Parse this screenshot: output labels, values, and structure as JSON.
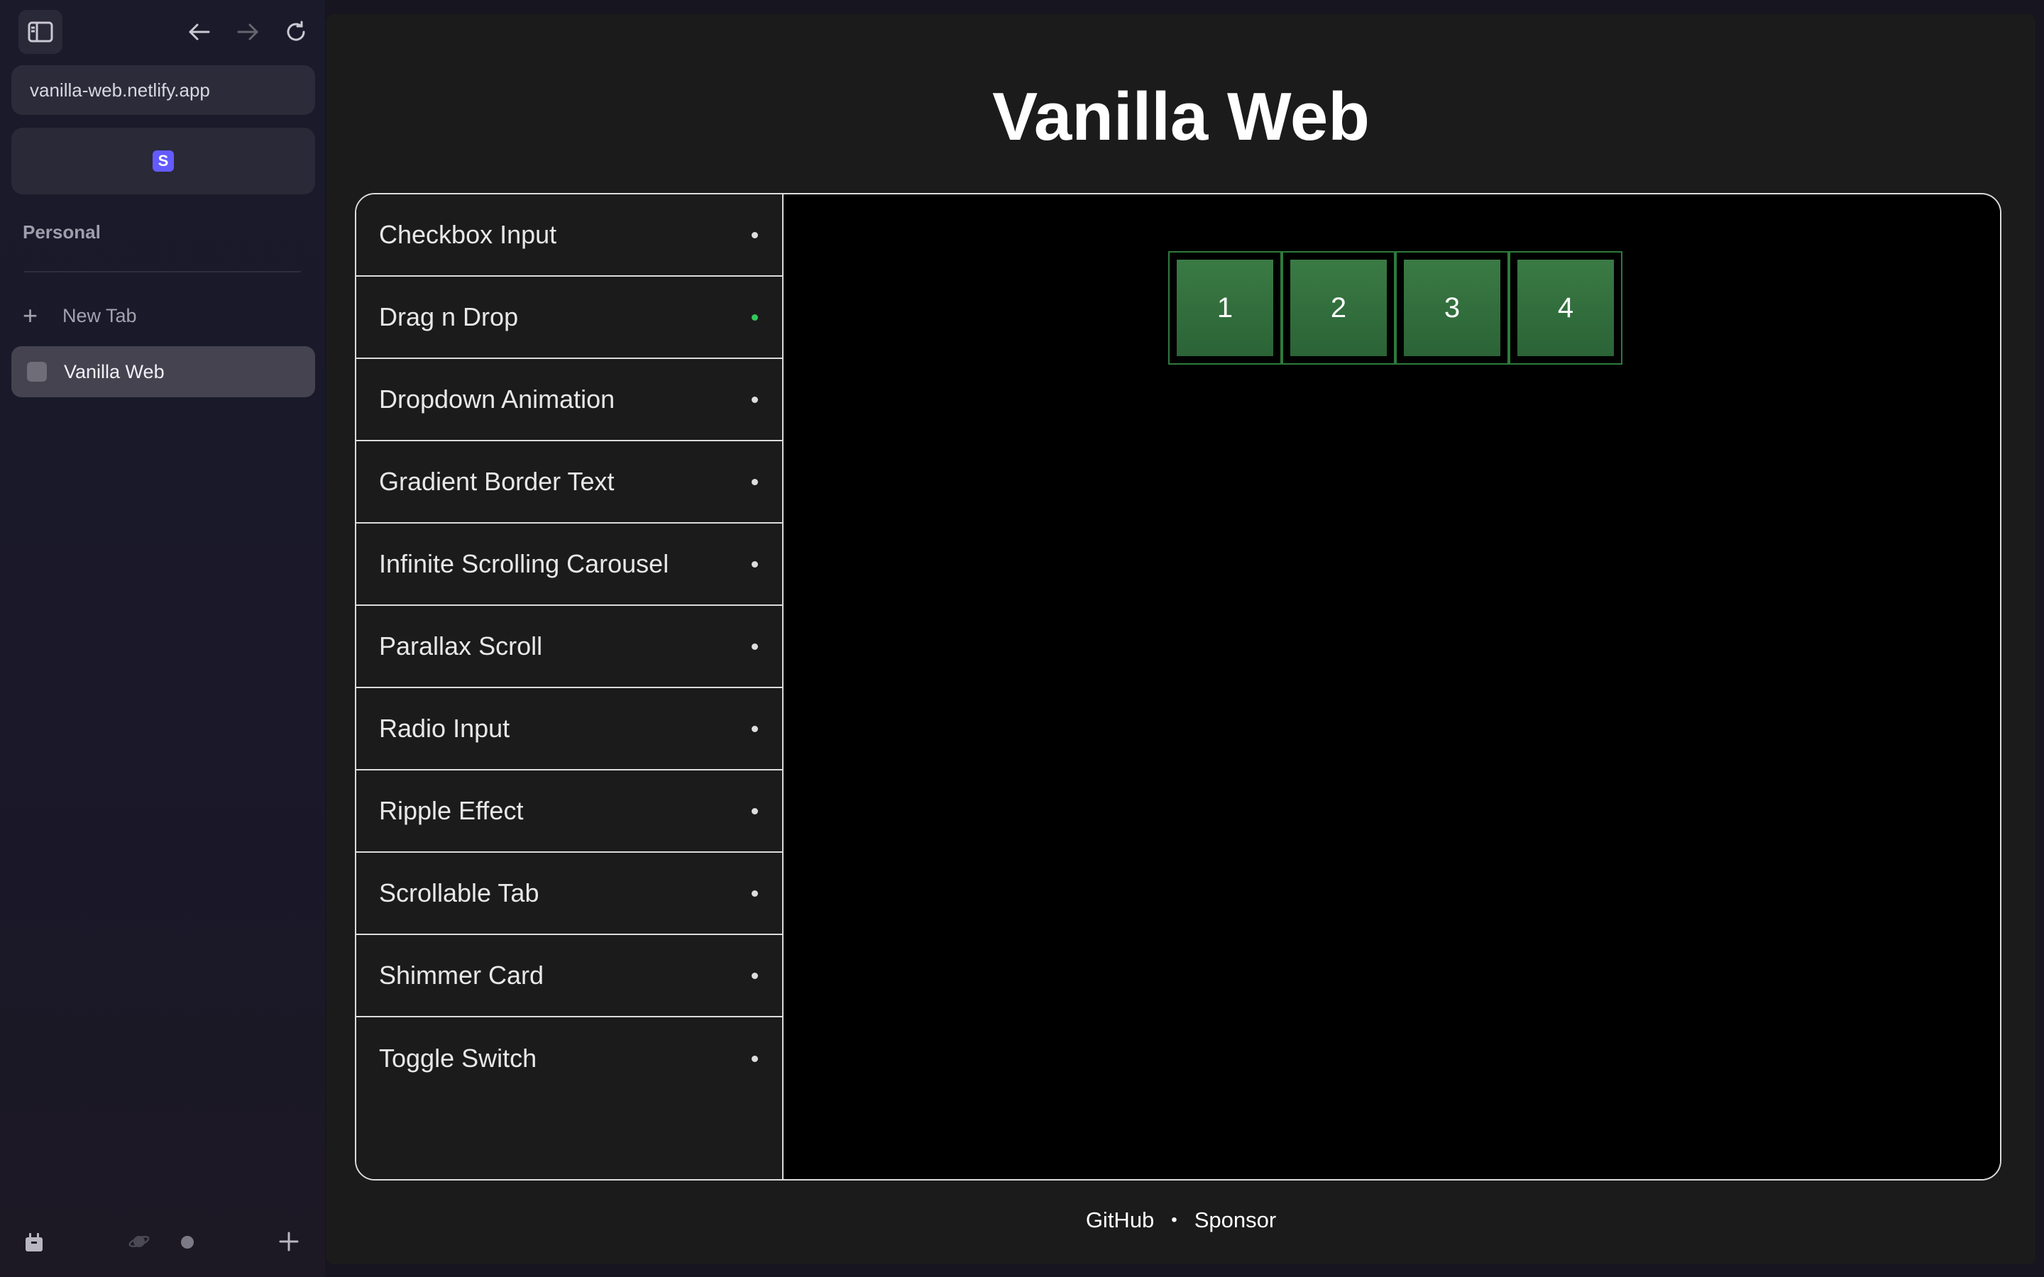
{
  "browser": {
    "url": "vanilla-web.netlify.app",
    "pinned_favicon_letter": "S",
    "space_label": "Personal",
    "new_tab_label": "New Tab",
    "tabs": [
      {
        "label": "Vanilla Web"
      }
    ],
    "icons": {
      "toggle_sidebar": "sidebar-icon",
      "back": "arrow-left-icon",
      "forward": "arrow-right-icon",
      "reload": "reload-icon",
      "archive": "archive-icon",
      "space": "planet-icon",
      "add": "plus-icon"
    }
  },
  "page": {
    "title": "Vanilla Web",
    "demos": [
      {
        "label": "Checkbox Input",
        "active": false
      },
      {
        "label": "Drag n Drop",
        "active": true
      },
      {
        "label": "Dropdown Animation",
        "active": false
      },
      {
        "label": "Gradient Border Text",
        "active": false
      },
      {
        "label": "Infinite Scrolling Carousel",
        "active": false
      },
      {
        "label": "Parallax Scroll",
        "active": false
      },
      {
        "label": "Radio Input",
        "active": false
      },
      {
        "label": "Ripple Effect",
        "active": false
      },
      {
        "label": "Scrollable Tab",
        "active": false
      },
      {
        "label": "Shimmer Card",
        "active": false
      },
      {
        "label": "Toggle Switch",
        "active": false
      }
    ],
    "drag_cards": [
      "1",
      "2",
      "3",
      "4"
    ],
    "footer": {
      "github": "GitHub",
      "separator": "•",
      "sponsor": "Sponsor"
    }
  },
  "colors": {
    "active_dot": "#34c759",
    "card_green": "#2f6d3a",
    "pinned_accent": "#635bff"
  }
}
